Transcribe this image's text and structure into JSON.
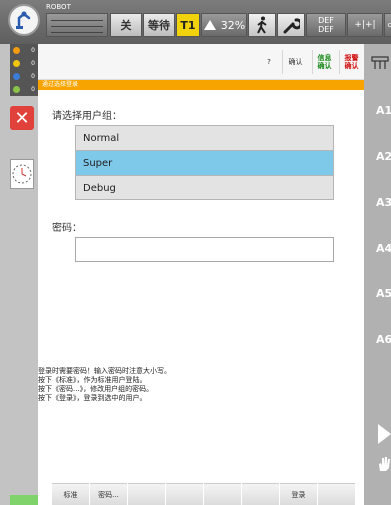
{
  "topbar": {
    "robot_label": "ROBOT",
    "btn_off": "关",
    "btn_wait": "等待",
    "btn_mode": "T1",
    "speed": "32%",
    "def_line1": "DEF",
    "def_line2": "DEF",
    "t1_color": "#f2d20a"
  },
  "status_leds": [
    {
      "color": "#f39c12",
      "count": "0"
    },
    {
      "color": "#f1c40f",
      "count": "0"
    },
    {
      "color": "#3b7dd8",
      "count": "0"
    },
    {
      "color": "#8bc34a",
      "count": "0"
    }
  ],
  "header": {
    "help": "?",
    "confirm": "确认",
    "info_confirm": "信息\n确认",
    "alarm_confirm": "报警\n确认"
  },
  "banner": "通过选择登录",
  "login": {
    "group_label": "请选择用户组：",
    "groups": [
      "Normal",
      "Super",
      "Debug"
    ],
    "selected": "Super",
    "password_label": "密码：",
    "password_value": "",
    "selected_color": "#7ec8e9"
  },
  "help_text": [
    "登录时需要密码！输入密码时注意大小写。",
    "按下《标准》，作为标准用户登陆。",
    "按下《密码...》，修改用户组的密码。",
    "按下《登录》，登录到选中的用户。"
  ],
  "softkeys": [
    "标准",
    "密码...",
    "",
    "",
    "",
    "",
    "登录",
    ""
  ],
  "axes": [
    "A1",
    "A2",
    "A3",
    "A4",
    "A5",
    "A6"
  ],
  "icons": {
    "logo": "robot-logo-icon",
    "speed": "speed-icon",
    "run_mode": "walking-person-icon",
    "tool": "wrench-icon",
    "jog": "jog-arrows-icon",
    "close": "close-icon",
    "clock": "clock-icon",
    "start": "play-icon",
    "hand": "hand-icon"
  },
  "colors": {
    "banner": "#f7a400",
    "close_button": "#e0413a"
  }
}
